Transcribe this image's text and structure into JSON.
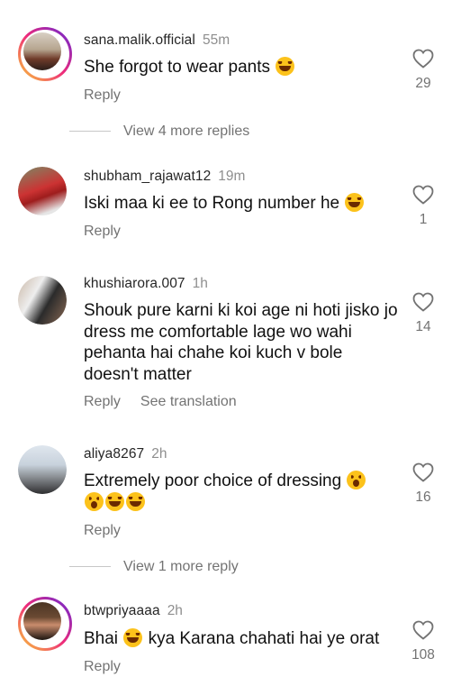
{
  "comments": [
    {
      "username": "sana.malik.official",
      "time": "55m",
      "text_parts": [
        "She forgot to wear pants "
      ],
      "emojis": [
        "laugh"
      ],
      "actions": [
        "Reply"
      ],
      "likes": "29",
      "avatar_ring": true
    },
    {
      "username": "shubham_rajawat12",
      "time": "19m",
      "text_parts": [
        "Iski maa ki ee to Rong number he "
      ],
      "emojis": [
        "laugh"
      ],
      "actions": [
        "Reply"
      ],
      "likes": "1",
      "avatar_ring": false
    },
    {
      "username": "khushiarora.007",
      "time": "1h",
      "text_parts": [
        "Shouk pure karni ki koi age ni hoti jisko jo dress me comfortable lage wo wahi pehanta hai chahe koi kuch v bole doesn't matter"
      ],
      "emojis": [],
      "actions": [
        "Reply",
        "See translation"
      ],
      "likes": "14",
      "avatar_ring": false
    },
    {
      "username": "aliya8267",
      "time": "2h",
      "text_parts": [
        "Extremely poor choice of dressing "
      ],
      "emojis": [
        "wow",
        "wow",
        "laugh",
        "laugh"
      ],
      "actions": [
        "Reply"
      ],
      "likes": "16",
      "avatar_ring": false
    },
    {
      "username": "btwpriyaaaa",
      "time": "2h",
      "text_parts": [
        "Bhai ",
        " kya Karana chahati hai ye orat"
      ],
      "emojis": [
        "laugh"
      ],
      "actions": [
        "Reply"
      ],
      "likes": "108",
      "avatar_ring": true
    }
  ],
  "view_more": [
    {
      "label": "View 4 more replies"
    },
    {
      "label": "View 1 more reply"
    }
  ],
  "icons": {
    "like": "heart-outline-icon"
  },
  "colors": {
    "text": "#262626",
    "muted": "#737373",
    "ring_gradient": [
      "#f9ce34",
      "#ee2a7b",
      "#6228d7"
    ]
  }
}
